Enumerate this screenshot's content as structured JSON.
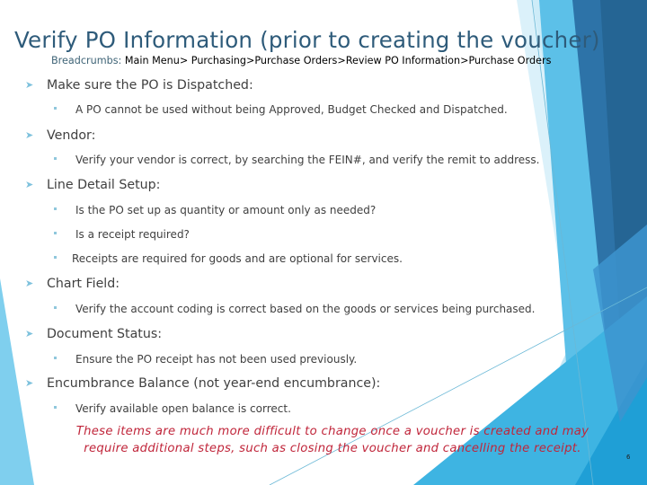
{
  "slide": {
    "title": "Verify PO Information (prior to creating the voucher)",
    "breadcrumbs": {
      "label": "Breadcrumbs:",
      "path": "Main Menu> Purchasing>Purchase Orders>Review PO Information>Purchase Orders"
    },
    "sections": [
      {
        "heading": "Make sure the PO is Dispatched:",
        "items": [
          "A PO cannot be used without being Approved, Budget Checked and Dispatched."
        ]
      },
      {
        "heading": "Vendor:",
        "items": [
          "Verify your vendor is correct, by searching the FEIN#, and verify the remit to address."
        ]
      },
      {
        "heading": "Line Detail Setup:",
        "items": [
          "Is the PO set up as quantity or amount only as needed?",
          "Is a receipt required?",
          "Receipts are required for goods and are optional for services."
        ]
      },
      {
        "heading": "Chart Field:",
        "items": [
          "Verify the account coding is correct based on the goods or services being purchased."
        ]
      },
      {
        "heading": "Document Status:",
        "items": [
          "Ensure the PO receipt has not been used previously."
        ]
      },
      {
        "heading": "Encumbrance Balance (not year-end encumbrance):",
        "items": [
          "Verify available open balance is correct."
        ]
      }
    ],
    "note": {
      "line1": "These items are much more difficult to change once a voucher is created and may",
      "line2": "require additional steps, such as closing the voucher and cancelling the receipt."
    },
    "page_number": "6",
    "icons": {
      "level1_bullet": "arrow-bullet-icon",
      "level2_bullet": "square-bullet-icon"
    },
    "colors": {
      "title": "#2e5b7a",
      "note": "#c0253a",
      "accent_dark": "#2a6a9c",
      "accent_mid": "#3fa6d8",
      "accent_light": "#7fcfee"
    }
  }
}
